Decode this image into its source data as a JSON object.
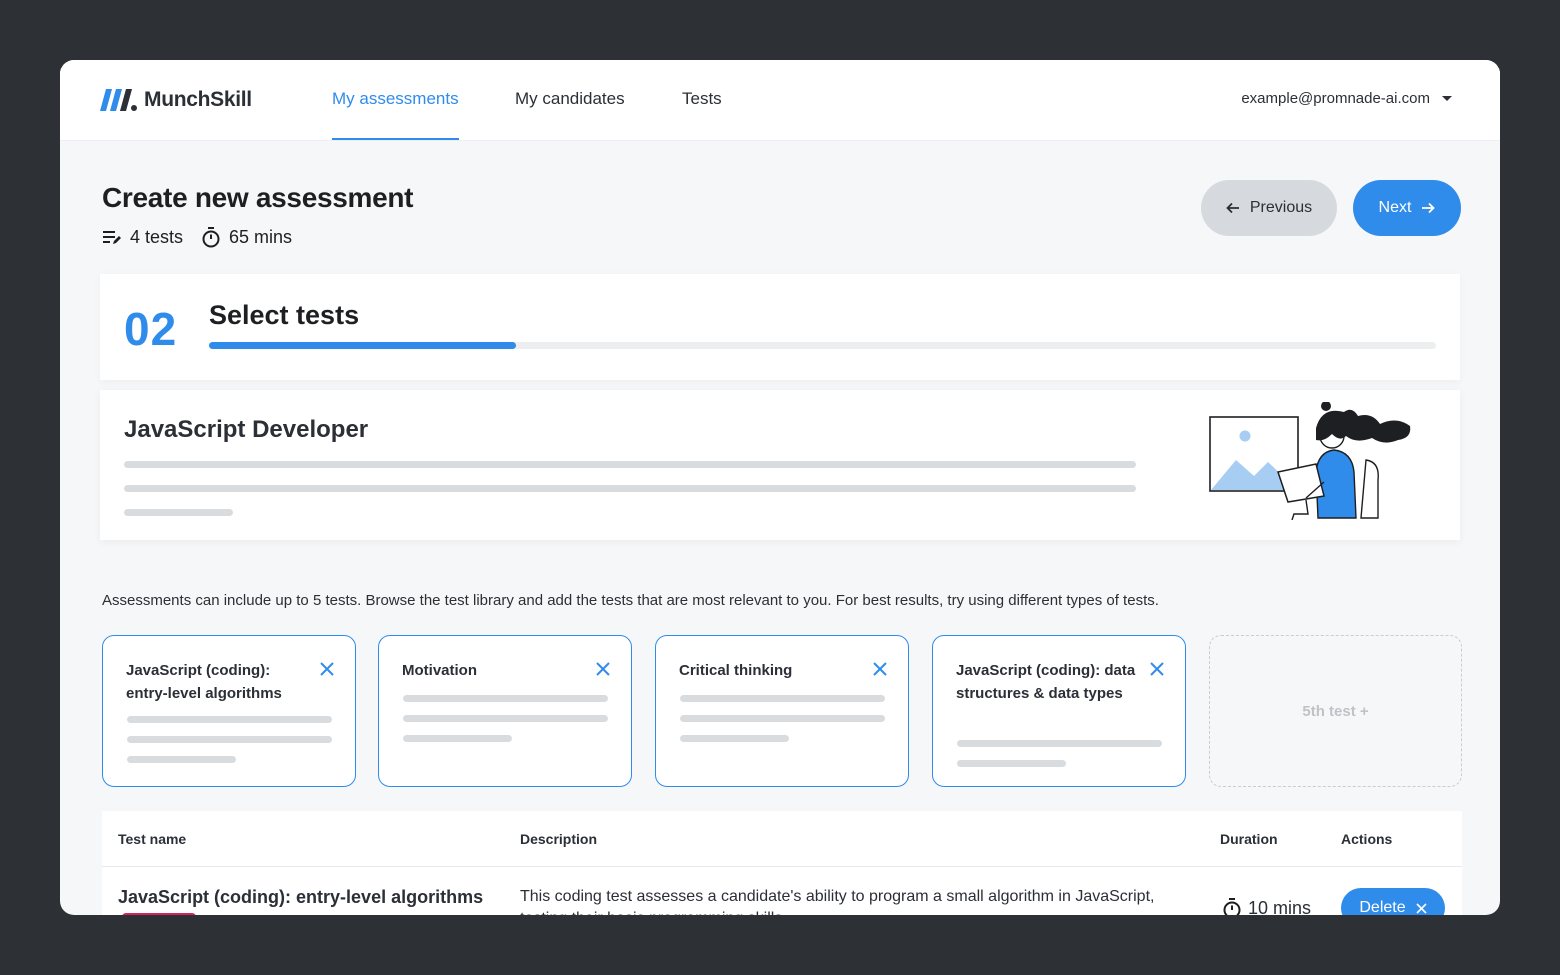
{
  "nav": {
    "brand": "MunchSkill",
    "items": [
      {
        "label": "My assessments",
        "active": true
      },
      {
        "label": "My candidates",
        "active": false
      },
      {
        "label": "Tests",
        "active": false
      }
    ],
    "user_email": "example@promnade-ai.com"
  },
  "header": {
    "title": "Create new assessment",
    "tests_count": "4 tests",
    "duration": "65 mins",
    "previous_label": "Previous",
    "next_label": "Next"
  },
  "step": {
    "number": "02",
    "title": "Select tests",
    "progress_fraction": 0.25
  },
  "role": {
    "title": "JavaScript Developer"
  },
  "info_text": "Assessments can include up to 5 tests. Browse the test library and add the tests that are most relevant to you. For best results, try using different types of tests.",
  "selected_tests": [
    {
      "name": "JavaScript (coding): entry-level algorithms"
    },
    {
      "name": "Motivation"
    },
    {
      "name": "Critical thinking"
    },
    {
      "name": "JavaScript (coding): data structures & data types"
    }
  ],
  "add_test_label": "5th test +",
  "table": {
    "headers": {
      "name": "Test name",
      "description": "Description",
      "duration": "Duration",
      "actions": "Actions"
    },
    "rows": [
      {
        "name": "JavaScript (coding): entry-level algorithms",
        "description": "This coding test assesses a candidate's ability to program a small algorithm in JavaScript, testing their basic programming skills.",
        "duration": "10 mins",
        "action_label": "Delete"
      }
    ]
  },
  "colors": {
    "accent": "#2f8ceb",
    "badge": "#d6235e"
  }
}
